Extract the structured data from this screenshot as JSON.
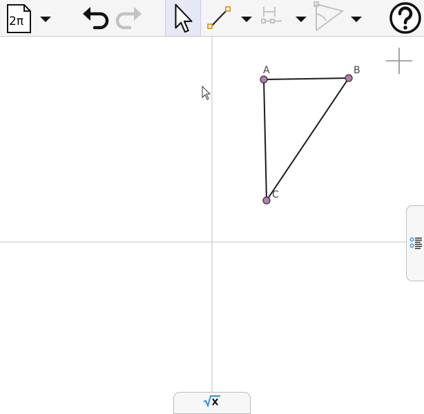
{
  "toolbar": {
    "menu_label": "2π",
    "items": [
      {
        "name": "menu",
        "icon": "document-icon"
      },
      {
        "name": "undo",
        "icon": "undo-icon"
      },
      {
        "name": "redo",
        "icon": "redo-icon",
        "enabled": false
      },
      {
        "name": "move",
        "icon": "move-arrow-icon",
        "selected": true
      },
      {
        "name": "segment",
        "icon": "segment-tool-icon"
      },
      {
        "name": "perpendicular",
        "icon": "perpendicular-tool-icon"
      },
      {
        "name": "angle",
        "icon": "angle-tool-icon"
      },
      {
        "name": "help",
        "icon": "help-icon"
      }
    ]
  },
  "graphics": {
    "points": [
      {
        "label": "A",
        "x": 0.75,
        "y": 2.35
      },
      {
        "label": "B",
        "x": 1.98,
        "y": 2.37
      },
      {
        "label": "C",
        "x": 0.79,
        "y": 0.6
      }
    ],
    "segments": [
      [
        "A",
        "B"
      ],
      [
        "B",
        "C"
      ],
      [
        "C",
        "A"
      ]
    ],
    "point_color": "#b27eb2",
    "axes_color": "#d5d5d5"
  },
  "input_bar": {
    "icon": "sqrt-x-icon"
  },
  "side_panel": {
    "icon": "algebra-view-icon"
  }
}
